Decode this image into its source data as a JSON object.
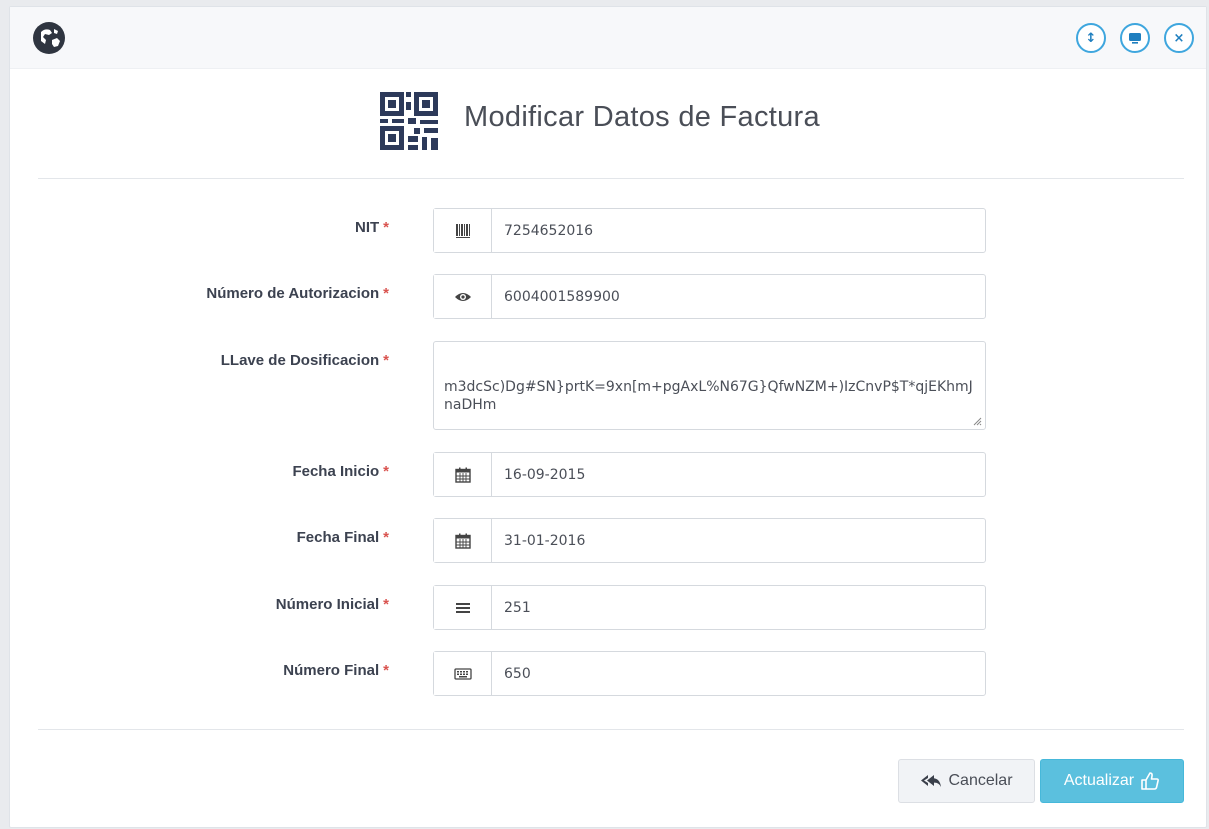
{
  "header": {
    "buttons": [
      {
        "icon": "resize-vertical-icon",
        "glyph": "↕"
      },
      {
        "icon": "monitor-icon",
        "glyph": "▭"
      },
      {
        "icon": "close-icon",
        "glyph": "×"
      }
    ]
  },
  "title": "Modificar Datos de Factura",
  "form": {
    "nit": {
      "label": "NIT",
      "value": "7254652016",
      "icon": "barcode-icon"
    },
    "autorizacion": {
      "label": "Número de Autorizacion",
      "value": "6004001589900",
      "icon": "eye-icon"
    },
    "llave": {
      "label": "LLave de Dosificacion",
      "value": "m3dcSc)Dg#SN}prtK=9xn[m+pgAxL%N67G}QfwNZM+)IzCnvP$T*qjEKhmJnaDHm"
    },
    "fecha_inicio": {
      "label": "Fecha Inicio",
      "value": "16-09-2015",
      "icon": "calendar-icon"
    },
    "fecha_final": {
      "label": "Fecha Final",
      "value": "31-01-2016",
      "icon": "calendar-icon"
    },
    "numero_inicial": {
      "label": "Número Inicial",
      "value": "251",
      "icon": "list-icon"
    },
    "numero_final": {
      "label": "Número Final",
      "value": "650",
      "icon": "keyboard-icon"
    },
    "required_mark": "*"
  },
  "actions": {
    "cancel_label": "Cancelar",
    "update_label": "Actualizar"
  },
  "colors": {
    "accent": "#5bc0de",
    "required": "#d9534f",
    "header_button_border": "#3ea6de"
  }
}
